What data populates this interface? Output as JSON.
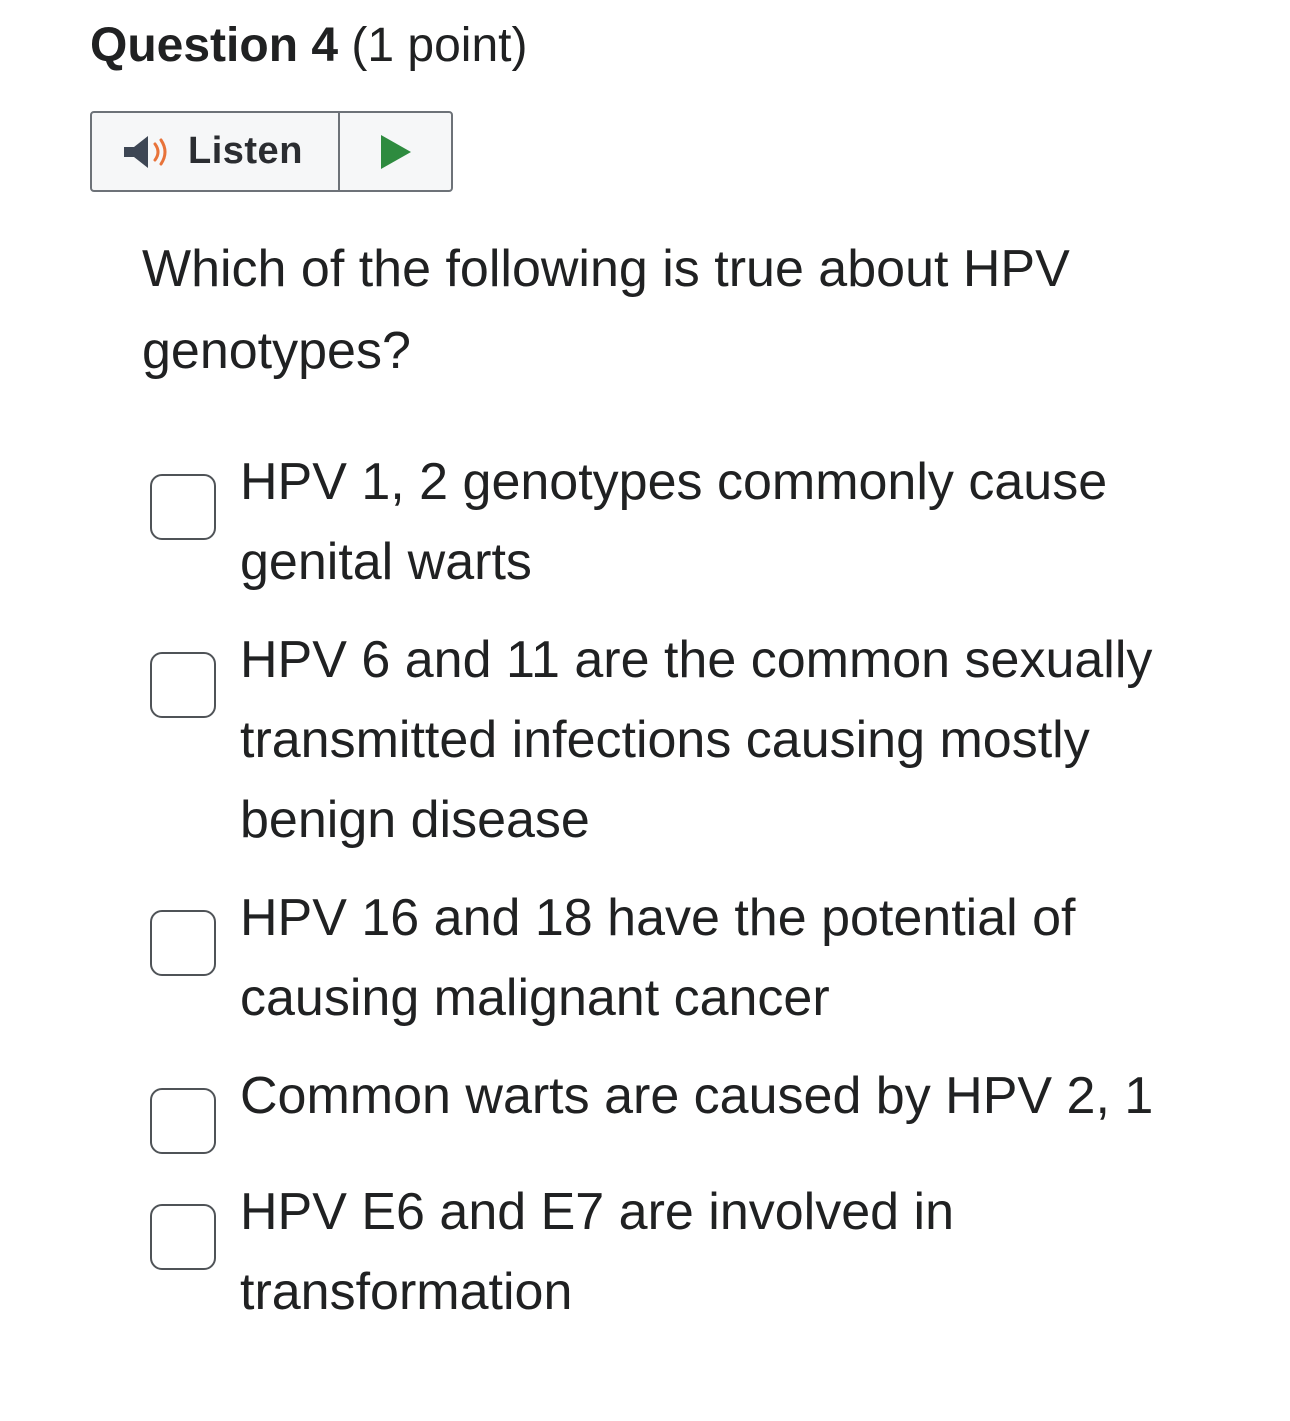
{
  "question": {
    "number_label": "Question 4",
    "points_label": "(1 point)",
    "text": "Which of the following is true about HPV genotypes?"
  },
  "listen": {
    "label": "Listen",
    "icons": {
      "speaker": "speaker-icon",
      "play": "play-icon"
    },
    "colors": {
      "speaker_body": "#3d4654",
      "speaker_waves": "#e8733a",
      "play": "#2e8b3f"
    }
  },
  "options": [
    {
      "label": "HPV 1, 2 genotypes commonly cause genital warts",
      "checked": false
    },
    {
      "label": "HPV 6 and 11 are the common sexually transmitted infections causing mostly benign disease",
      "checked": false
    },
    {
      "label": "HPV 16 and 18 have the potential of causing malignant cancer",
      "checked": false
    },
    {
      "label": "Common warts are caused by HPV 2, 1",
      "checked": false
    },
    {
      "label": "HPV E6 and E7 are involved in transformation",
      "checked": false
    }
  ]
}
